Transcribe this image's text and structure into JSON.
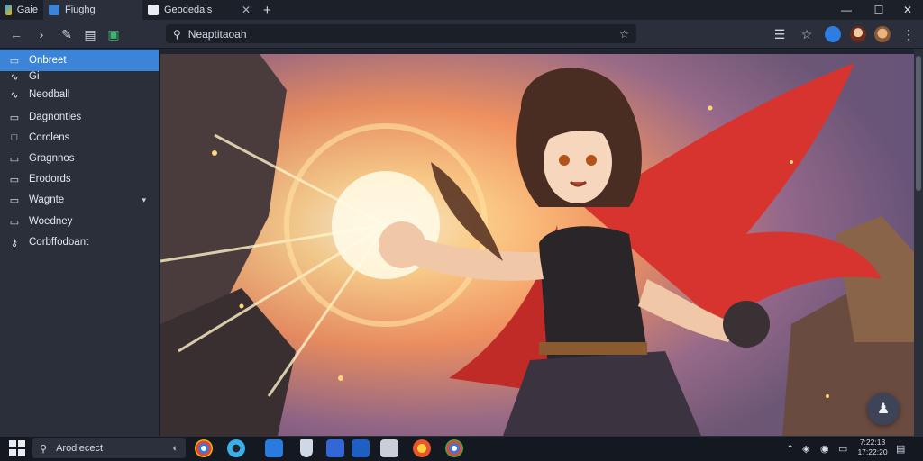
{
  "browser": {
    "tabs": [
      {
        "label": "Gaie",
        "icon": "browser-logo-icon"
      },
      {
        "label": "Fiughg",
        "icon": "tab-favicon-icon"
      },
      {
        "label": "Geodedals",
        "icon": "tab-favicon-icon"
      }
    ],
    "new_tab": "+",
    "window_controls": [
      "minimize",
      "maximize",
      "close"
    ]
  },
  "toolbar": {
    "address": "Neaptitaoah",
    "buttons": [
      "back-icon",
      "forward-icon",
      "edit-icon",
      "extensions-icon",
      "shield-icon"
    ],
    "right_buttons": [
      "reading-list-icon",
      "bookmark-star-icon",
      "profile-avatars"
    ]
  },
  "sidebar": {
    "items": [
      {
        "label": "Onbreet",
        "icon": "chat-icon",
        "active": true
      },
      {
        "label": "Gi",
        "icon": "link-icon",
        "active": false
      },
      {
        "label": "Neodball",
        "icon": "link-icon",
        "active": false
      },
      {
        "label": "Dagnonties",
        "icon": "chat-icon",
        "active": false
      },
      {
        "label": "Corclens",
        "icon": "square-icon",
        "active": false
      },
      {
        "label": "Gragnnos",
        "icon": "chat-icon",
        "active": false
      },
      {
        "label": "Erodords",
        "icon": "chat-icon",
        "active": false
      },
      {
        "label": "Wagnte",
        "icon": "chat-icon",
        "active": false,
        "has_chevron": true
      },
      {
        "label": "Woedney",
        "icon": "chat-icon",
        "active": false
      },
      {
        "label": "Corbffodoant",
        "icon": "key-icon",
        "active": false
      }
    ]
  },
  "main": {
    "image_subject": "anime-heroine-illustration",
    "fab_icon": "user-assist-icon"
  },
  "taskbar": {
    "search_placeholder": "Arodlecect",
    "apps": [
      "chrome-icon",
      "edge-icon",
      "store-icon",
      "shield-icon",
      "puzzle-icon",
      "outlook-icon",
      "notepad-icon",
      "firefox-icon",
      "chrome-icon"
    ],
    "time": "7:22:13",
    "date": "17:22:20"
  },
  "colors": {
    "accent": "#3b84d8",
    "sidebar_bg": "#2a2f39",
    "chrome_bg": "#2a2f3b"
  }
}
